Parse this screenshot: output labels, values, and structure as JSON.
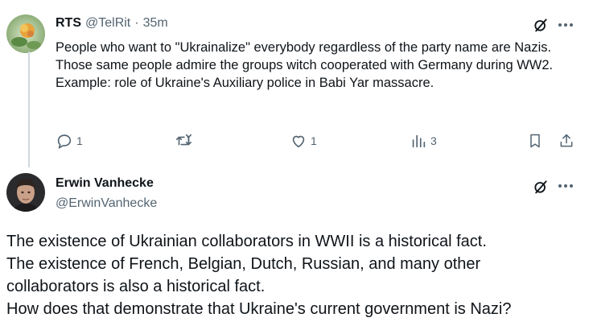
{
  "tweet1": {
    "author_name": "RTS",
    "handle": "@TelRit",
    "separator": "·",
    "time": "35m",
    "text": "People who want to \"Ukrainalize\" everybody regardless of the party name are Nazis. Those same people admire the groups witch cooperated with Germany during WW2. Example: role of Ukraine's Auxiliary police in Babi Yar massacre.",
    "reply_count": "1",
    "like_count": "1",
    "views_count": "3"
  },
  "tweet2": {
    "author_name": "Erwin Vanhecke",
    "handle": "@ErwinVanhecke",
    "text_lines": [
      "The existence of Ukrainian collaborators in WWII is a historical fact.",
      "The existence of French, Belgian, Dutch, Russian, and many other",
      "collaborators is also a historical fact.",
      "How does that demonstrate that Ukraine's current government is Nazi?"
    ]
  },
  "icons": [
    "grok-icon",
    "more-icon",
    "reply-icon",
    "retweet-icon",
    "like-icon",
    "views-icon",
    "bookmark-icon",
    "share-icon"
  ],
  "colors": {
    "text": "#0f1419",
    "secondary": "#536471",
    "thread_line": "#cfd9de"
  }
}
